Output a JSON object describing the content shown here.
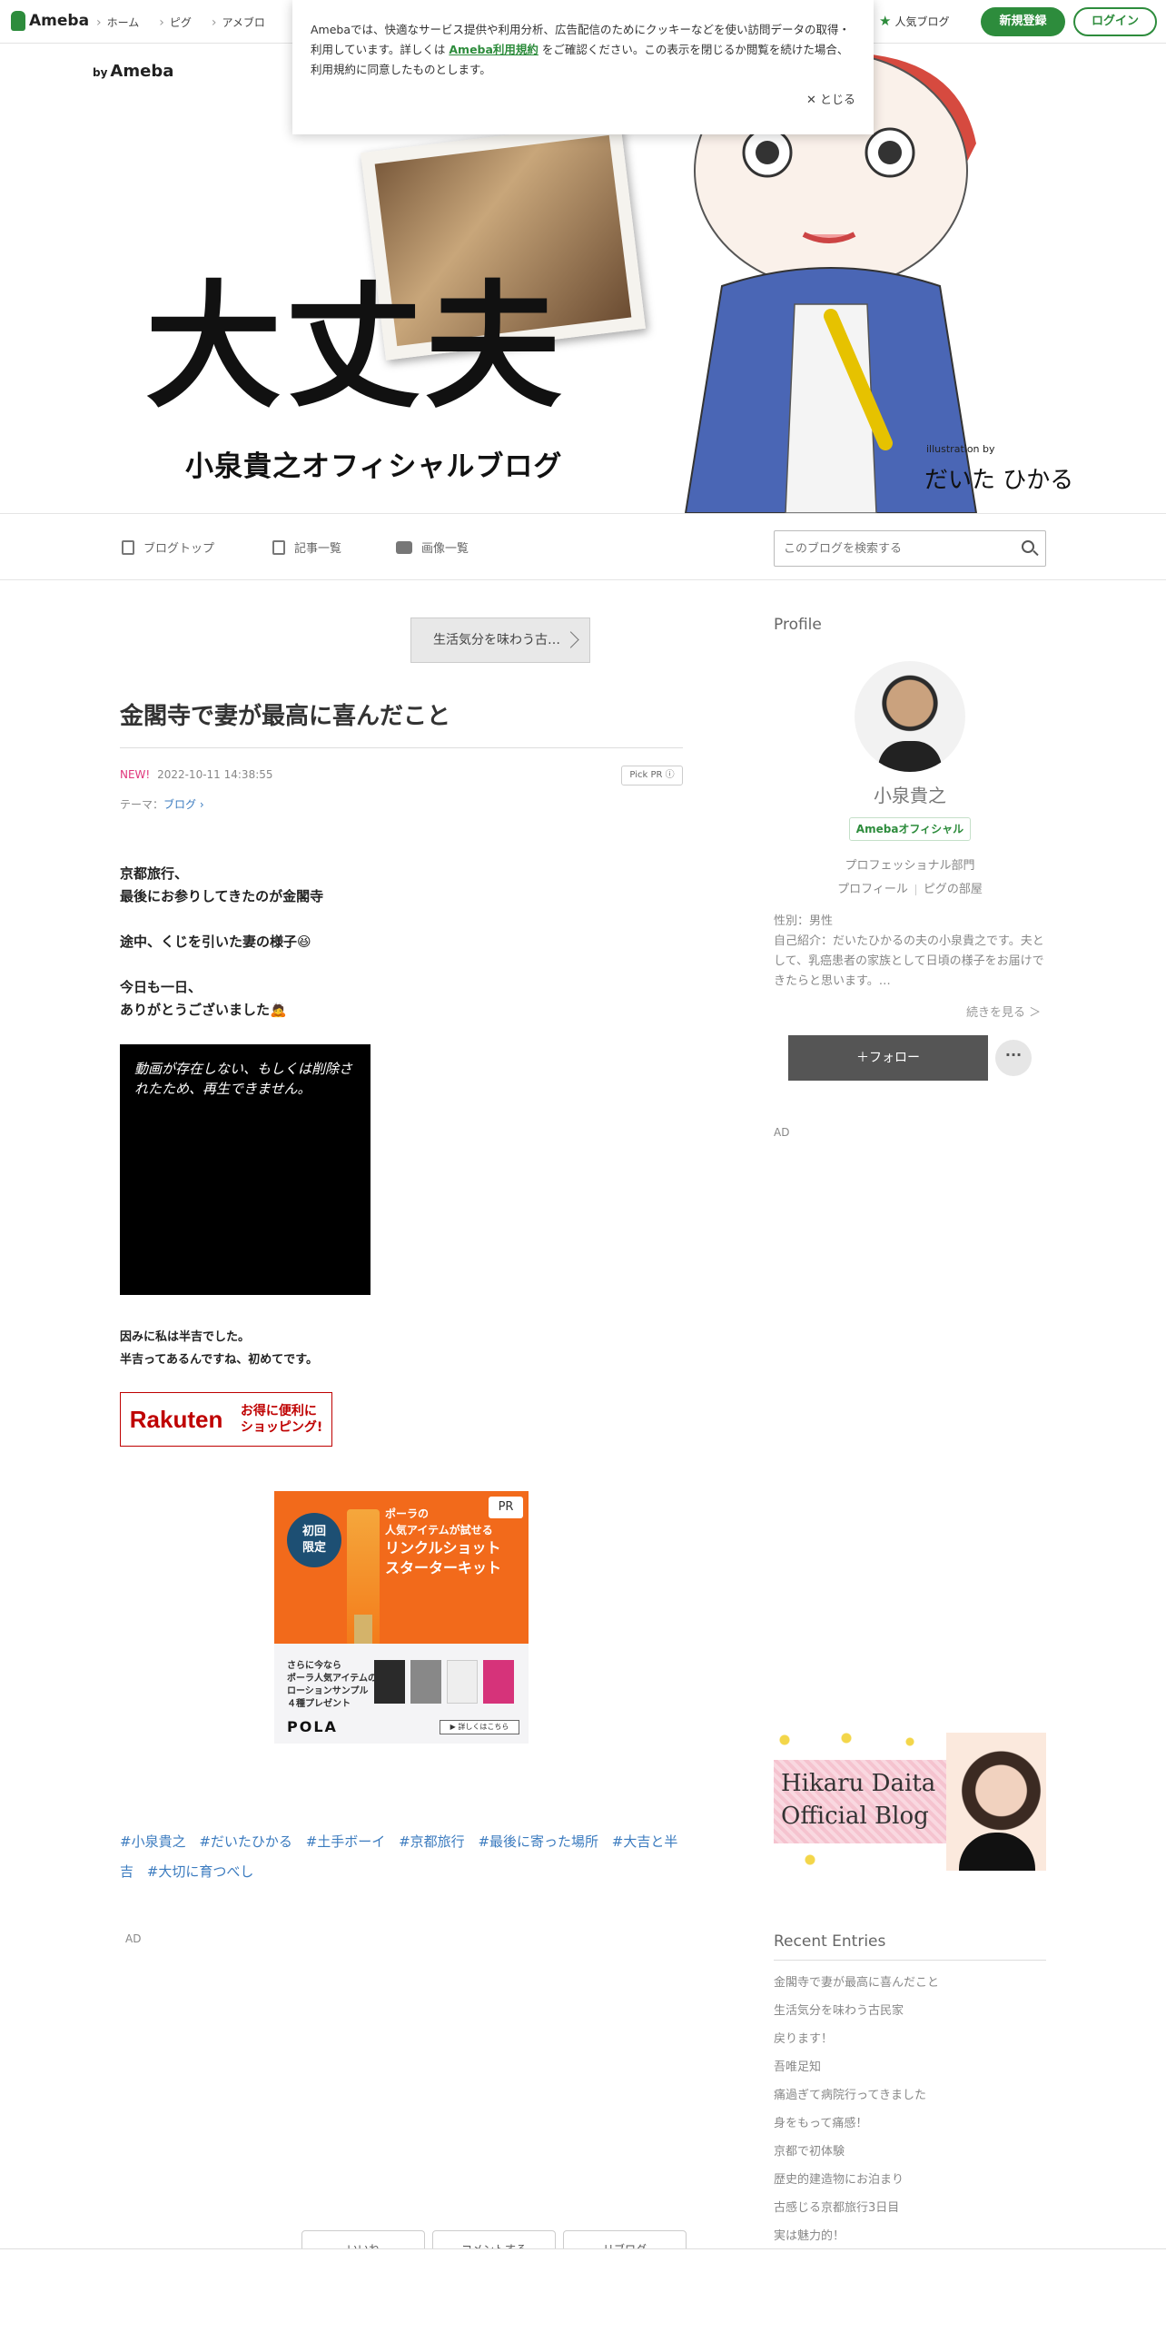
{
  "header": {
    "logo": "Ameba",
    "nav": [
      "ホーム",
      "ピグ",
      "アメブロ"
    ],
    "popular": "人気ブログ",
    "signup": "新規登録",
    "login": "ログイン"
  },
  "cookie": {
    "text_before": "Amebaでは、快適なサービス提供や利用分析、広告配信のためにクッキーなどを使い訪問データの取得・利用しています。詳しくは",
    "link": "Ameba利用規約",
    "text_after": "をご確認ください。この表示を閉じるか閲覧を続けた場合、利用規約に同意したものとします。",
    "close": "✕ とじる"
  },
  "banner": {
    "by": "by",
    "brand": "Ameba",
    "title": "大丈夫",
    "subtitle": "小泉貴之オフィシャルブログ",
    "credit": "illustration by",
    "illustrator": "だいた ひかる"
  },
  "blognav": {
    "top": "ブログトップ",
    "list": "記事一覧",
    "images": "画像一覧",
    "search_placeholder": "このブログを検索する"
  },
  "article": {
    "prev": "生活気分を味わう古…",
    "title": "金閣寺で妻が最高に喜んだこと",
    "new": "NEW!",
    "date": "2022-10-11 14:38:55",
    "pickpr": "Pick PR ⓘ",
    "theme_label": "テーマ：",
    "theme": "ブログ ›",
    "p1a": "京都旅行、",
    "p1b": "最後にお参りしてきたのが金閣寺",
    "p2": "途中、くじを引いた妻の様子😆",
    "p3a": "今日も一日、",
    "p3b": "ありがとうございました🙇",
    "video": "動画が存在しない、もしくは削除されたため、再生できません。",
    "p4a": "因みに私は半吉でした。",
    "p4b": "半吉ってあるんですね、初めてです。",
    "rakuten": "Rakuten",
    "rakuten_copy1": "お得に便利に",
    "rakuten_copy2": "ショッピング!",
    "hashtags": [
      "#小泉貴之",
      "#だいたひかる",
      "#土手ボーイ",
      "#京都旅行",
      "#最後に寄った場所",
      "#大吉と半吉",
      "#大切に育つべし"
    ],
    "ad": "AD"
  },
  "pola_ad": {
    "pr": "PR",
    "badge1": "初回",
    "badge2": "限定",
    "lead1": "ポーラの",
    "lead2": "人気アイテムが試せる",
    "head1": "リンクルショット",
    "head2": "スターターキット",
    "sample1": "さらに今なら",
    "sample2": "ポーラ人気アイテムの",
    "sample3": "ローションサンプル",
    "sample4": "４種プレゼント",
    "logo": "POLA",
    "more": "▶ 詳しくはこちら"
  },
  "sidebar": {
    "profile_heading": "Profile",
    "name": "小泉貴之",
    "official": "Amebaオフィシャル",
    "dept": "プロフェッショナル部門",
    "profile_link": "プロフィール",
    "pig_link": "ピグの部屋",
    "gender": "性別：男性",
    "intro": "自己紹介：だいたひかるの夫の小泉貴之です。夫として、乳癌患者の家族として日頃の様子をお届けできたらと思います。…",
    "more": "続きを見る ＞",
    "follow": "＋フォロー",
    "dots": "···",
    "ad": "AD",
    "hikaru_line1": "Hikaru Daita",
    "hikaru_line2": "Official Blog",
    "recent_heading": "Recent Entries",
    "recent": [
      "金閣寺で妻が最高に喜んだこと",
      "生活気分を味わう古民家",
      "戻ります！",
      "吾唯足知",
      "痛過ぎて病院行ってきました",
      "身をもって痛感！",
      "京都で初体験",
      "歴史的建造物にお泊まり",
      "古感じる京都旅行3日目",
      "実は魅力的！"
    ]
  },
  "footer_buttons": [
    "いいね",
    "コメントする",
    "リブログ"
  ],
  "colors": {
    "brand_green": "#2d8c3c",
    "new_pink": "#e0357b",
    "link_blue": "#3b7bbf",
    "rakuten_red": "#bf0000",
    "pola_orange": "#f26a1b"
  }
}
